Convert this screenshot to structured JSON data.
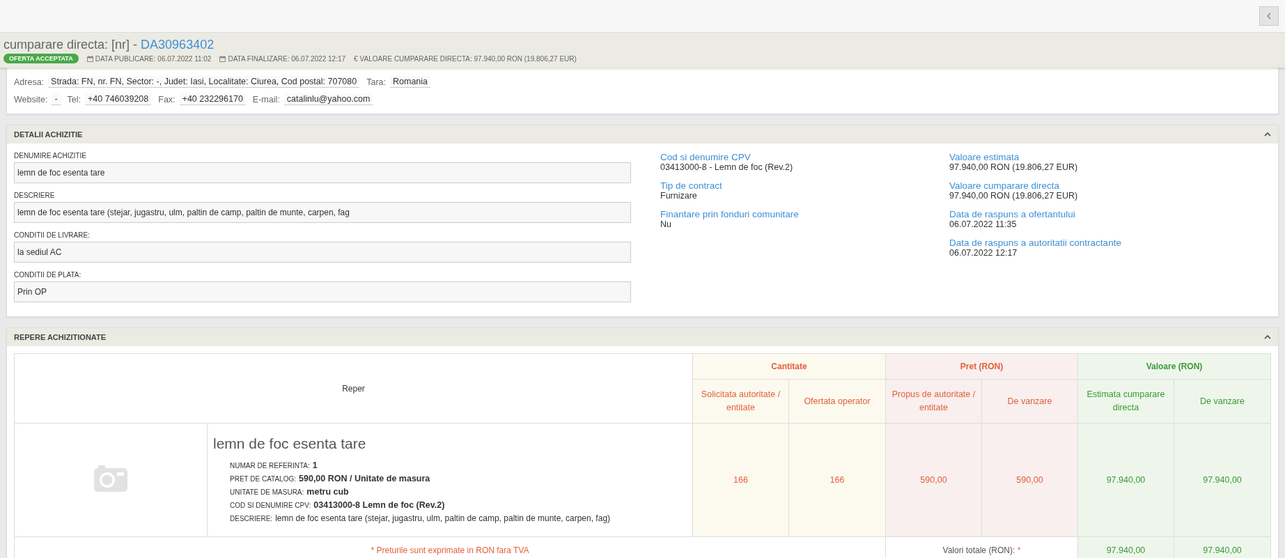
{
  "header": {
    "title_prefix": "cumparare directa: [nr] - ",
    "code": "DA30963402",
    "status": "OFERTA ACCEPTATA",
    "meta": [
      {
        "kind": "date",
        "text": "DATA PUBLICARE: 06.07.2022 11:02"
      },
      {
        "kind": "date",
        "text": "DATA FINALIZARE: 06.07.2022 12:17"
      },
      {
        "kind": "value",
        "symbol": "€",
        "text": "VALOARE CUMPARARE DIRECTA: 97.940,00  RON (19.806,27  EUR)"
      }
    ]
  },
  "contact": {
    "address_line": [
      {
        "label": "Adresa:",
        "value": "Strada: FN, nr. FN, Sector: -, Judet: Iasi, Localitate: Ciurea, Cod postal: 707080"
      },
      {
        "label": "Tara:",
        "value": "Romania"
      }
    ],
    "communication_line": [
      {
        "label": "Website:",
        "value": "-"
      },
      {
        "label": "Tel:",
        "value": "+40 746039208"
      },
      {
        "label": "Fax:",
        "value": "+40 232296170"
      },
      {
        "label": "E-mail:",
        "value": "catalinlu@yahoo.com"
      }
    ]
  },
  "details": {
    "title": "DETALII ACHIZITIE",
    "expanded": true,
    "fields": [
      {
        "label": "DENUMIRE ACHIZITIE",
        "value": "lemn de foc esenta tare"
      },
      {
        "label": "DESCRIERE",
        "value": "lemn de foc esenta tare (stejar, jugastru, ulm, paltin de camp, paltin de munte, carpen, fag"
      },
      {
        "label": "CONDITII DE LIVRARE:",
        "value": "la sediul AC"
      },
      {
        "label": "CONDITII DE PLATA:",
        "value": "Prin OP"
      }
    ],
    "info_middle": [
      {
        "label": "Cod si denumire CPV",
        "value": "03413000-8 - Lemn de foc (Rev.2)"
      },
      {
        "label": "Tip de contract",
        "value": "Furnizare"
      },
      {
        "label": "Finantare prin fonduri comunitare",
        "value": "Nu"
      }
    ],
    "info_right": [
      {
        "label": "Valoare estimata",
        "value": "97.940,00  RON (19.806,27  EUR)"
      },
      {
        "label": "Valoare cumparare directa",
        "value": "97.940,00  RON (19.806,27  EUR)"
      },
      {
        "label": "Data de raspuns a ofertantului",
        "value": "06.07.2022 11:35"
      },
      {
        "label": "Data de raspuns a autoritatii contractante",
        "value": "06.07.2022 12:17"
      }
    ]
  },
  "items": {
    "title": "REPERE ACHIZITIONATE",
    "expanded": true,
    "reper_header": "Reper",
    "groups": [
      {
        "kind": "quantity",
        "label": "Cantitate",
        "columns": [
          "Solicitata autoritate / entitate",
          "Ofertata operator"
        ]
      },
      {
        "kind": "price",
        "label": "Pret (RON)",
        "columns": [
          "Propus de autoritate / entitate",
          "De vanzare"
        ]
      },
      {
        "kind": "value",
        "label": "Valoare (RON)",
        "columns": [
          "Estimata cumparare directa",
          "De vanzare"
        ]
      }
    ],
    "rows": [
      {
        "title": "lemn de foc esenta tare",
        "details": [
          {
            "label": "NUMAR DE REFERINTA:",
            "value": "1",
            "bold": true
          },
          {
            "label": "PRET DE CATALOG:",
            "value": "590,00  RON / Unitate de masura",
            "bold": true
          },
          {
            "label": "UNITATE DE MASURA:",
            "value": "metru cub",
            "bold": true
          },
          {
            "label": "COD SI DENUMIRE CPV:",
            "value": "03413000-8 Lemn de foc (Rev.2)",
            "bold": true
          },
          {
            "label": "DESCRIERE:",
            "value": "lemn de foc esenta tare (stejar, jugastru, ulm, paltin de camp, paltin de munte, carpen, fag)",
            "bold": false
          }
        ],
        "cells": [
          [
            "166",
            "166"
          ],
          [
            "590,00",
            "590,00"
          ],
          [
            "97.940,00",
            "97.940,00"
          ]
        ]
      }
    ],
    "note": "* Preturile sunt exprimate in RON fara TVA",
    "totals_label": "Valori totale (RON):",
    "totals_mark": "*",
    "totals": [
      "97.940,00",
      "97.940,00"
    ]
  }
}
